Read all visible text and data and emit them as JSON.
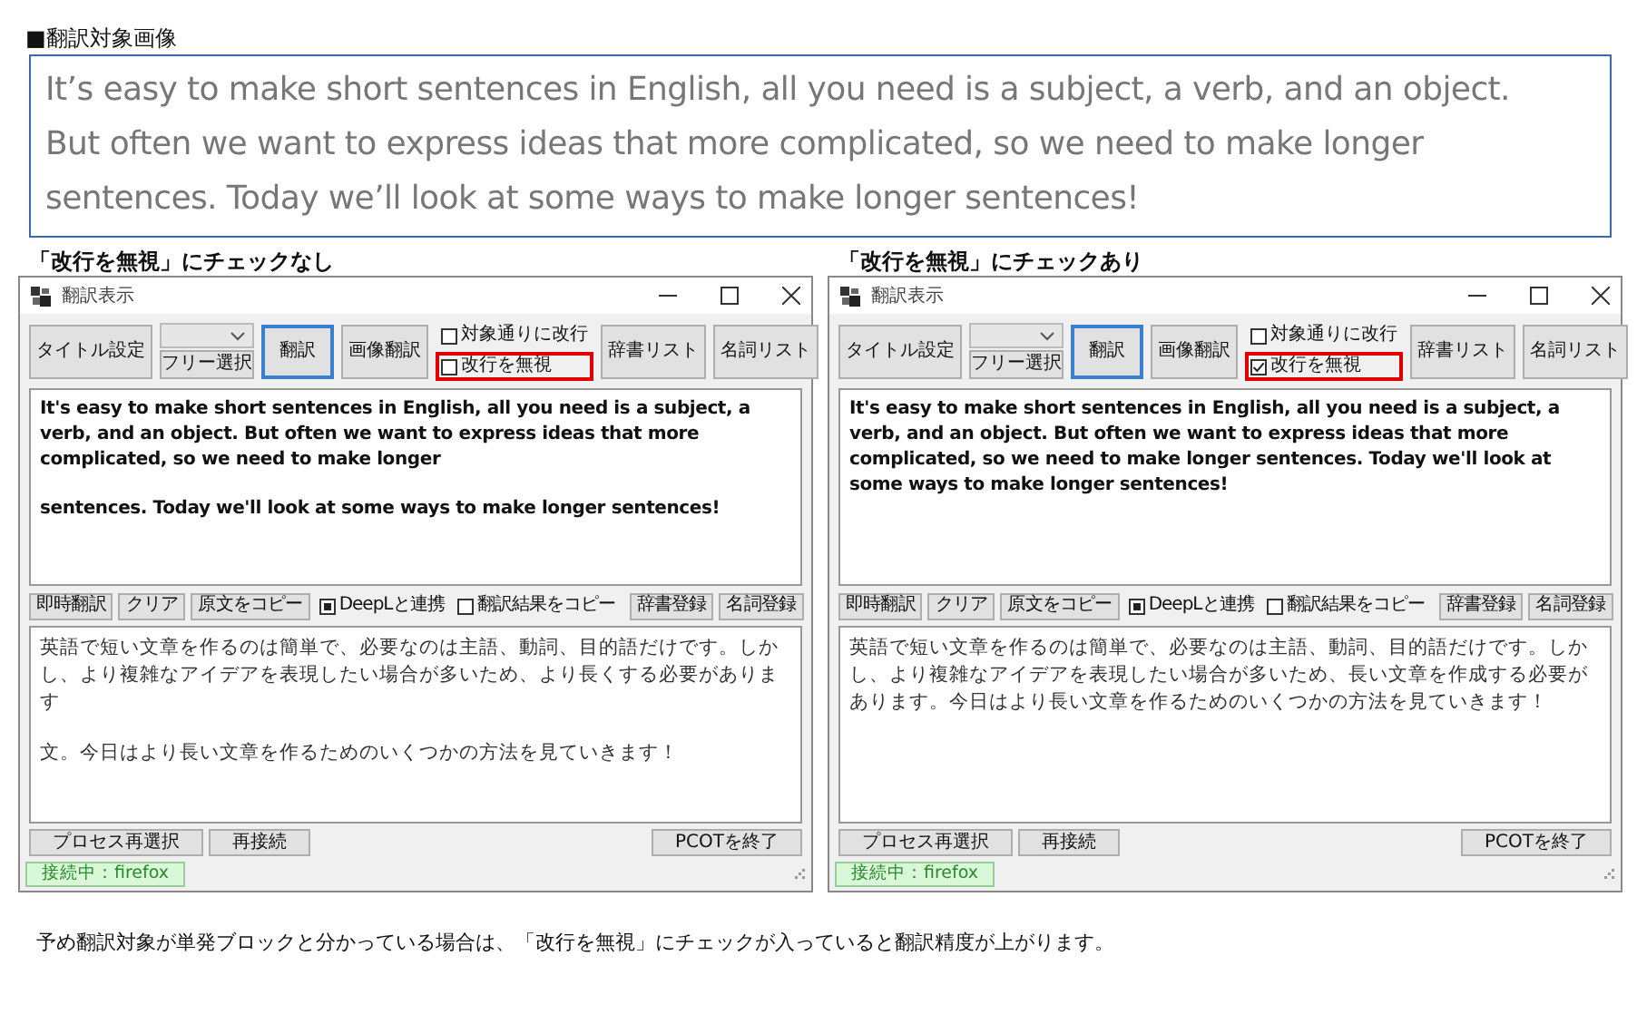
{
  "source_section": {
    "heading": "■翻訳対象画像",
    "lines": [
      "It’s easy to make short sentences in English, all you need is a subject, a verb, and an object.",
      "But often we want to express ideas that more complicated, so we need to make longer",
      "sentences. Today we’ll look at some ways to make longer sentences!"
    ]
  },
  "panels": [
    {
      "caption": "「改行を無視」にチェックなし",
      "window": {
        "title": "翻訳表示",
        "toolbar": {
          "title_button": "タイトル設定",
          "dropdown_button": "フリー選択",
          "translate_button": "翻訳",
          "image_translate_button": "画像翻訳",
          "checkboxes": [
            {
              "label": "対象通りに改行",
              "checked": false,
              "highlighted": false
            },
            {
              "label": "改行を無視",
              "checked": false,
              "highlighted": true
            }
          ],
          "dictionary_list_button": "辞書リスト",
          "noun_list_button": "名詞リスト"
        },
        "source_paragraphs": [
          "It's easy to make short sentences in English, all you need is a subject, a verb, and an object. But often we want to express ideas that more complicated, so we need to make longer",
          "sentences. Today we'll look at some ways to make longer sentences!"
        ],
        "action_buttons": [
          "即時翻訳",
          "クリア",
          "原文をコピー"
        ],
        "action_checkboxes": [
          {
            "label": "DeepLと連携",
            "checked": true
          },
          {
            "label": "翻訳結果をコピー",
            "checked": false
          }
        ],
        "register_buttons": [
          "辞書登録",
          "名詞登録"
        ],
        "translation_paragraphs": [
          "英語で短い文章を作るのは簡単で、必要なのは主語、動詞、目的語だけです。しかし、より複雑なアイデアを表現したい場合が多いため、より長くする必要があります",
          "文。今日はより長い文章を作るためのいくつかの方法を見ていきます！"
        ],
        "bottom_buttons": [
          "プロセス再選択",
          "再接続"
        ],
        "exit_button": "PCOTを終了",
        "status": "接続中：firefox"
      }
    },
    {
      "caption": "「改行を無視」にチェックあり",
      "window": {
        "title": "翻訳表示",
        "toolbar": {
          "title_button": "タイトル設定",
          "dropdown_button": "フリー選択",
          "translate_button": "翻訳",
          "image_translate_button": "画像翻訳",
          "checkboxes": [
            {
              "label": "対象通りに改行",
              "checked": false,
              "highlighted": false
            },
            {
              "label": "改行を無視",
              "checked": true,
              "highlighted": true
            }
          ],
          "dictionary_list_button": "辞書リスト",
          "noun_list_button": "名詞リスト"
        },
        "source_paragraphs": [
          "It's easy to make short sentences in English, all you need is a subject, a verb, and an object. But often we want to express ideas that more complicated, so we need to make longer sentences. Today we'll look at some ways to make longer sentences!"
        ],
        "action_buttons": [
          "即時翻訳",
          "クリア",
          "原文をコピー"
        ],
        "action_checkboxes": [
          {
            "label": "DeepLと連携",
            "checked": true
          },
          {
            "label": "翻訳結果をコピー",
            "checked": false
          }
        ],
        "register_buttons": [
          "辞書登録",
          "名詞登録"
        ],
        "translation_paragraphs": [
          "英語で短い文章を作るのは簡単で、必要なのは主語、動詞、目的語だけです。しかし、より複雑なアイデアを表現したい場合が多いため、長い文章を作成する必要があります。今日はより長い文章を作るためのいくつかの方法を見ていきます！"
        ],
        "bottom_buttons": [
          "プロセス再選択",
          "再接続"
        ],
        "exit_button": "PCOTを終了",
        "status": "接続中：firefox"
      }
    }
  ],
  "footer_note": "予め翻訳対象が単発ブロックと分かっている場合は、「改行を無視」にチェックが入っていると翻訳精度が上がります。"
}
